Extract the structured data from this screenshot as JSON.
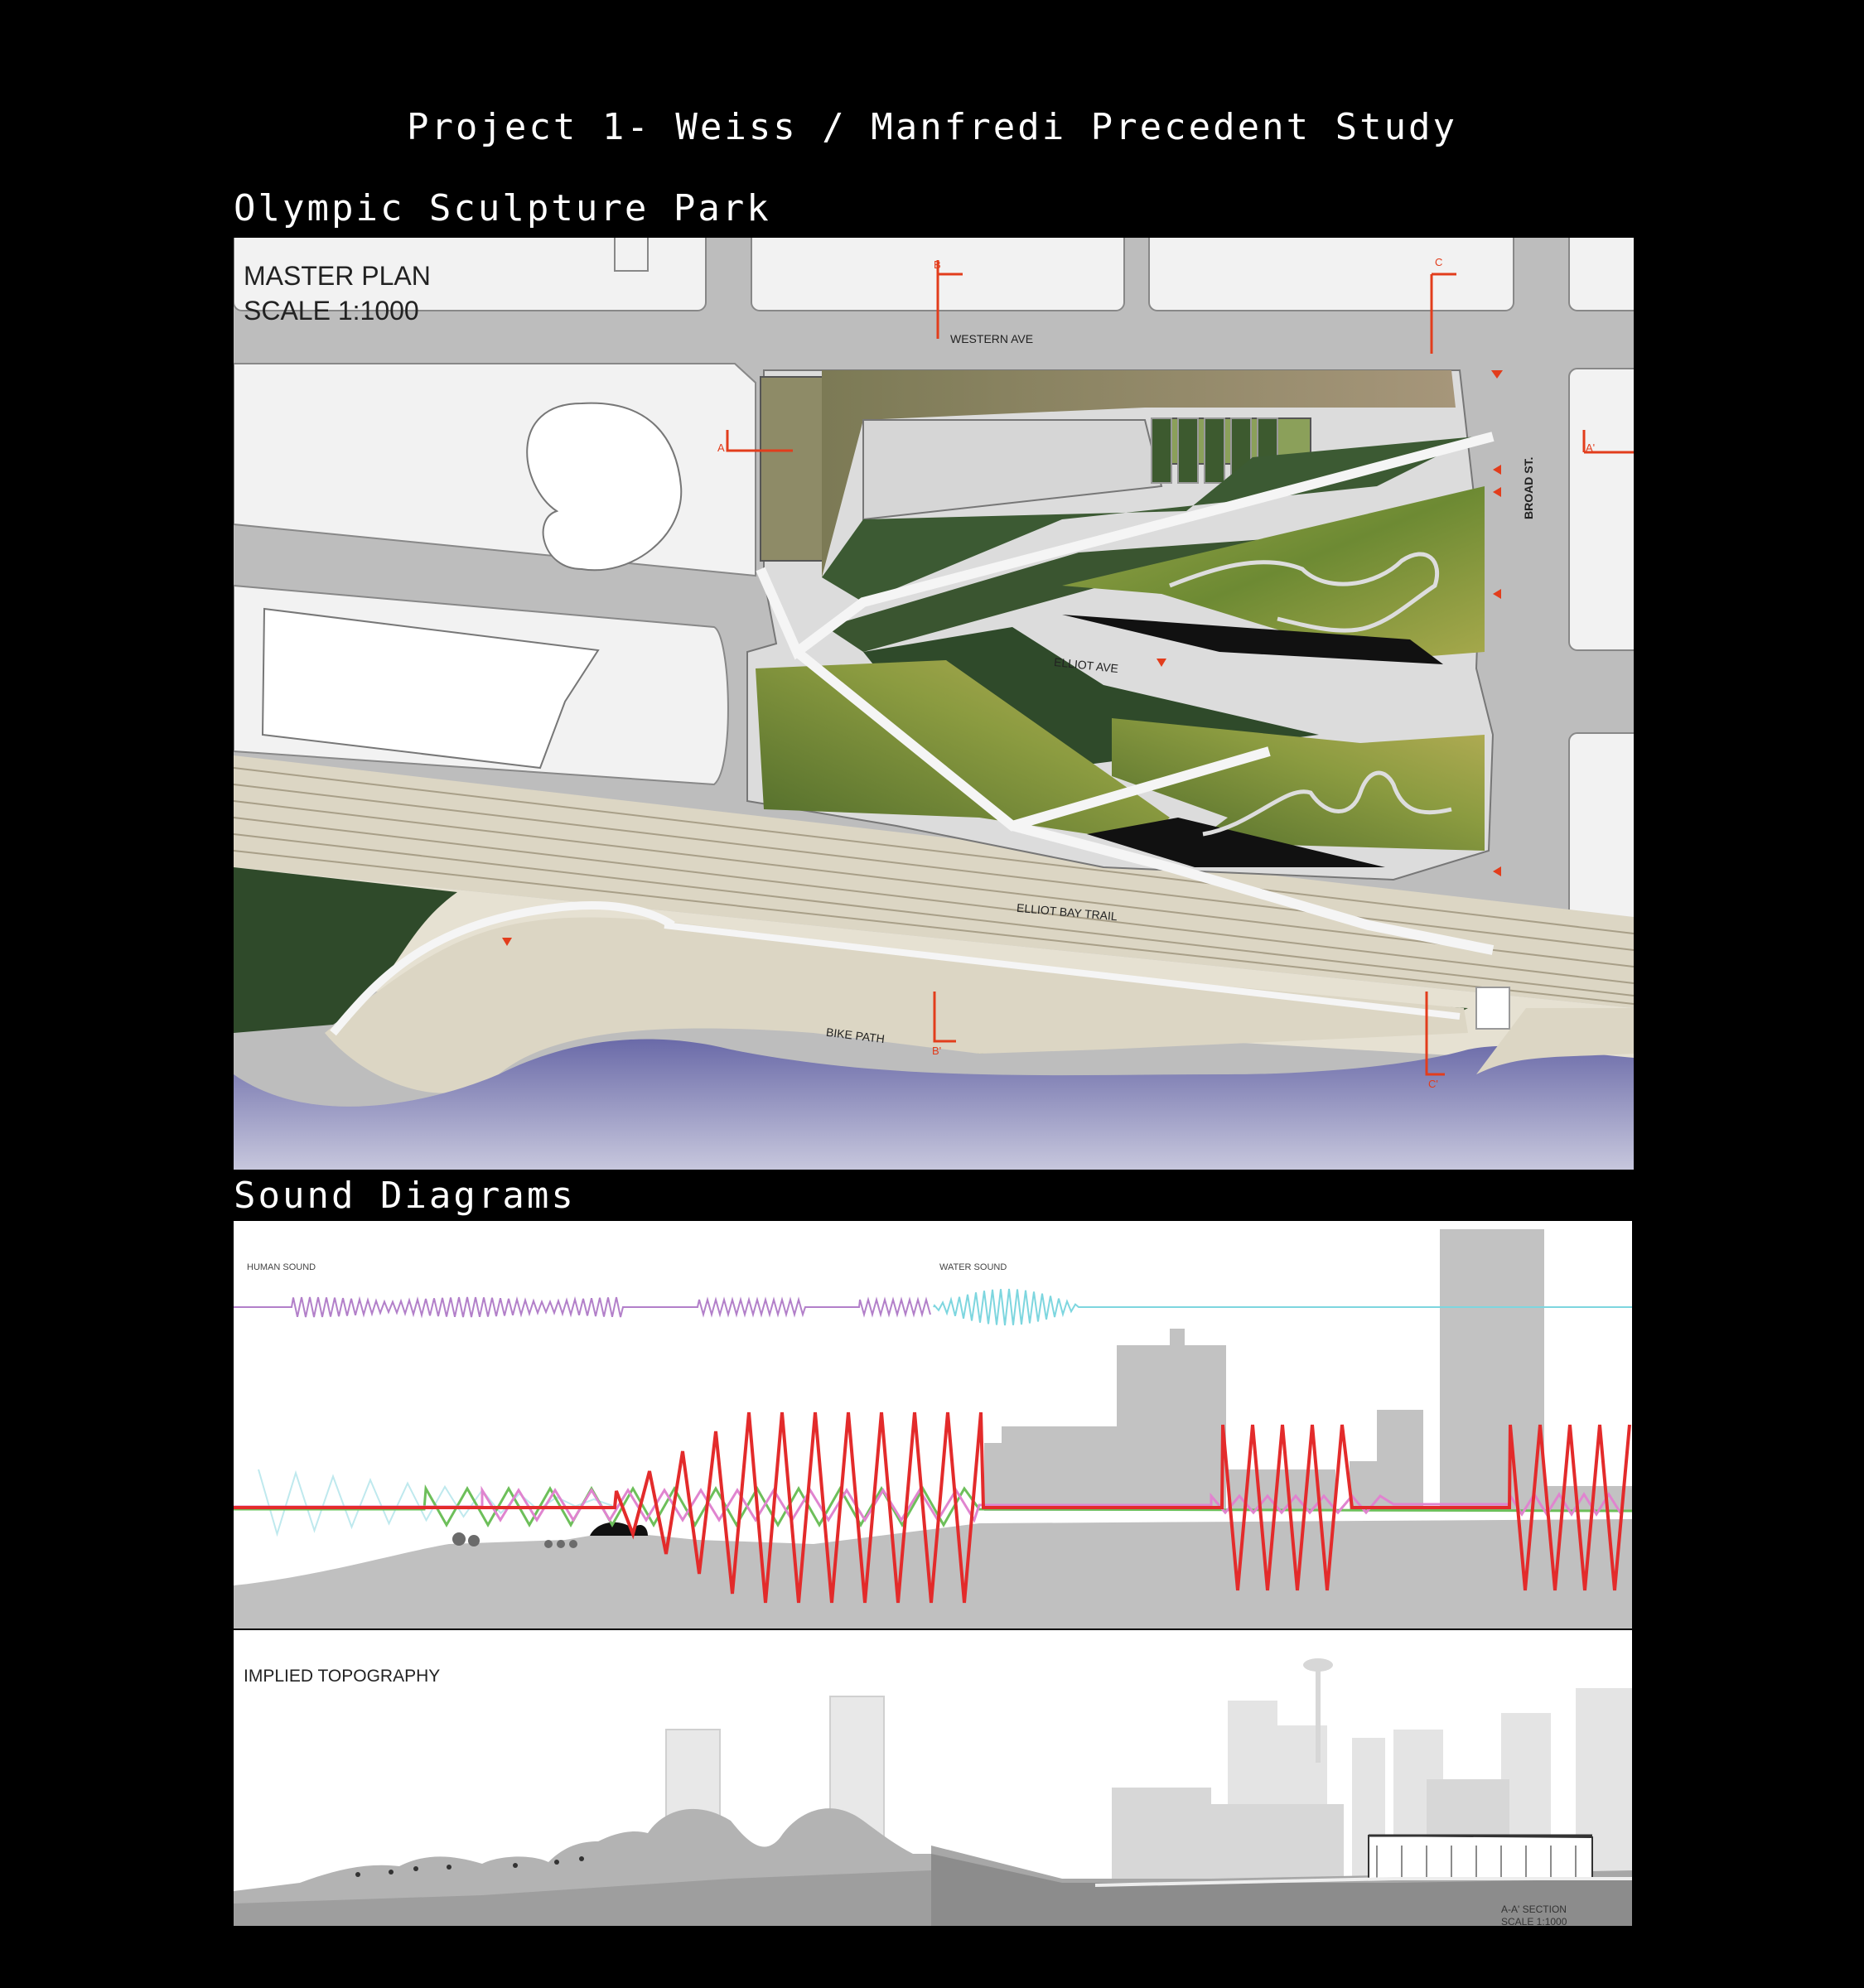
{
  "page_title": "Project 1- Weiss / Manfredi Precedent Study",
  "park_heading": "Olympic Sculpture Park",
  "sound_heading": "Sound Diagrams",
  "master_plan": {
    "title_line1": "MASTER PLAN",
    "title_line2": "SCALE 1:1000",
    "streets": {
      "western_ave": "WESTERN AVE",
      "elliot_ave": "ELLIOT AVE",
      "broad_st": "BROAD ST.",
      "elliot_bay_trail": "ELLIOT BAY TRAIL",
      "bike_path": "BIKE PATH"
    },
    "section_markers": {
      "a": "A",
      "a_prime": "A'",
      "b": "B",
      "b_prime": "B'",
      "c": "C",
      "c_prime": "C'"
    },
    "colors": {
      "road": "#bdbdbd",
      "block": "#f2f2f2",
      "water": "#55549a",
      "sand": "#dcd6c4",
      "green_dark": "#2f4a2a",
      "green_light": "#8a9a3f",
      "marker": "#e23d1c"
    }
  },
  "sound_diagram": {
    "human_sound_label": "HUMAN SOUND",
    "water_sound_label": "WATER SOUND",
    "colors": {
      "human": "#b27fc9",
      "water": "#7dd6df",
      "traffic": "#e32b2b",
      "green": "#6dbf5a",
      "pink": "#e084cf",
      "buildings": "#c2c2c2"
    }
  },
  "topography": {
    "title": "IMPLIED TOPOGRAPHY",
    "section_label_line1": "A-A' SECTION",
    "section_label_line2": "SCALE 1:1000"
  }
}
